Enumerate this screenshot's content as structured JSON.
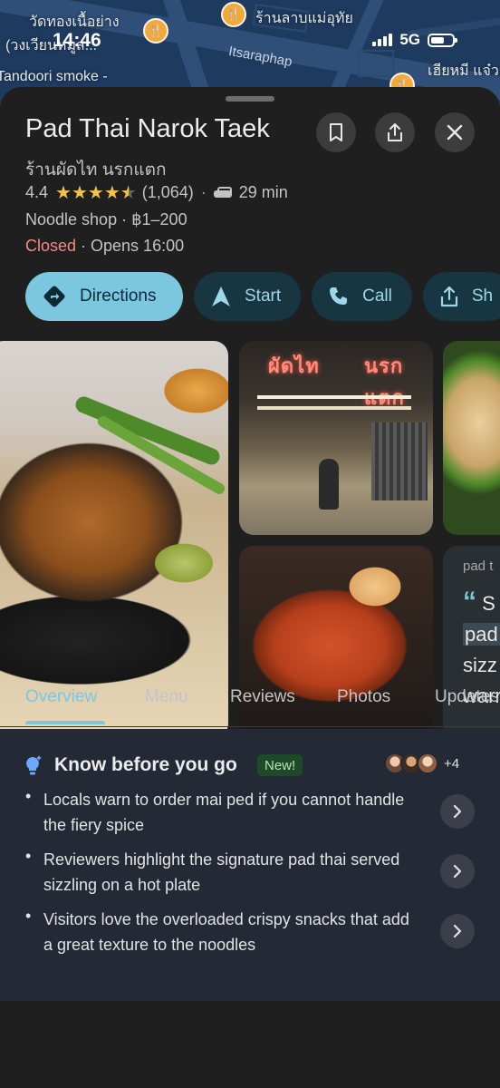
{
  "status_bar": {
    "time": "14:46",
    "network": "5G"
  },
  "map": {
    "labels": [
      "วัดทองเนื้อย่าง",
      "(วงเวียนหมูส...",
      "Tandoori smoke -",
      "ร้านลาบแม่อุทัย",
      "เฮียหมี แจ๋ว"
    ],
    "road_label": "Itsaraphap"
  },
  "place": {
    "name": "Pad Thai Narok Taek",
    "local_name": "ร้านผัดไท นรกแตก",
    "rating": "4.4",
    "review_count": "(1,064)",
    "drive_time": "29 min",
    "category": "Noodle shop · ฿1–200",
    "status": "Closed",
    "opens": " · Opens 16:00"
  },
  "actions": {
    "directions": "Directions",
    "start": "Start",
    "call": "Call",
    "share": "Sh"
  },
  "photos": {
    "shop_sign_left": "ผัดไท",
    "shop_sign_right": "นรกแตก"
  },
  "review_card": {
    "label": "pad t",
    "line1": "S",
    "line2": "pad",
    "line3": "sizz",
    "line4": "warr"
  },
  "tabs": [
    "Overview",
    "Menu",
    "Reviews",
    "Photos",
    "Updates"
  ],
  "know_before_you_go": {
    "title": "Know before you go",
    "badge": "New!",
    "more_count": "+4",
    "items": [
      "Locals warn to order mai ped if you cannot handle the fiery spice",
      "Reviewers highlight the signature pad thai served sizzling on a hot plate",
      "Visitors love the overloaded crispy snacks that add a great texture to the noodles"
    ]
  },
  "colors": {
    "accent": "#7cc7e0",
    "closed": "#f28b82",
    "star": "#f7c04b",
    "background": "#1f1f1f"
  }
}
